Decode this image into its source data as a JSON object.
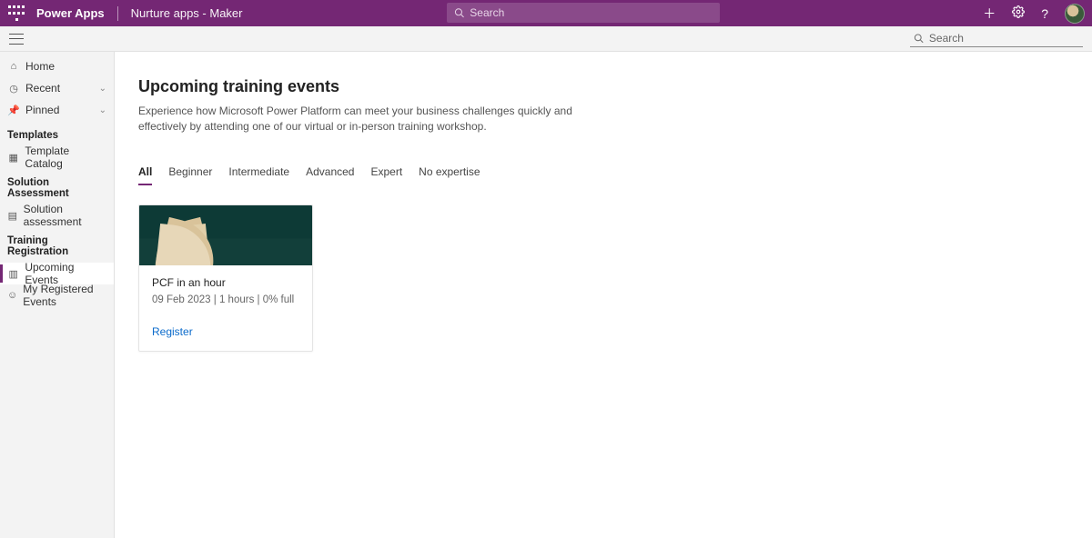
{
  "header": {
    "app_title": "Power Apps",
    "env_name": "Nurture apps - Maker",
    "search_placeholder": "Search"
  },
  "secondbar": {
    "search_placeholder": "Search"
  },
  "sidebar": {
    "home": "Home",
    "recent": "Recent",
    "pinned": "Pinned",
    "section_templates": "Templates",
    "template_catalog": "Template Catalog",
    "section_solution": "Solution Assessment",
    "solution_assessment": "Solution assessment",
    "section_training": "Training Registration",
    "upcoming_events": "Upcoming Events",
    "my_registered": "My Registered Events"
  },
  "main": {
    "title": "Upcoming training events",
    "description": "Experience how Microsoft Power Platform can meet your business challenges quickly and effectively by attending one of our virtual or in-person training workshop.",
    "tabs": {
      "all": "All",
      "beginner": "Beginner",
      "intermediate": "Intermediate",
      "advanced": "Advanced",
      "expert": "Expert",
      "no_expertise": "No expertise"
    },
    "card": {
      "title": "PCF in an hour",
      "meta": "09 Feb 2023 | 1 hours | 0% full",
      "register": "Register"
    }
  }
}
